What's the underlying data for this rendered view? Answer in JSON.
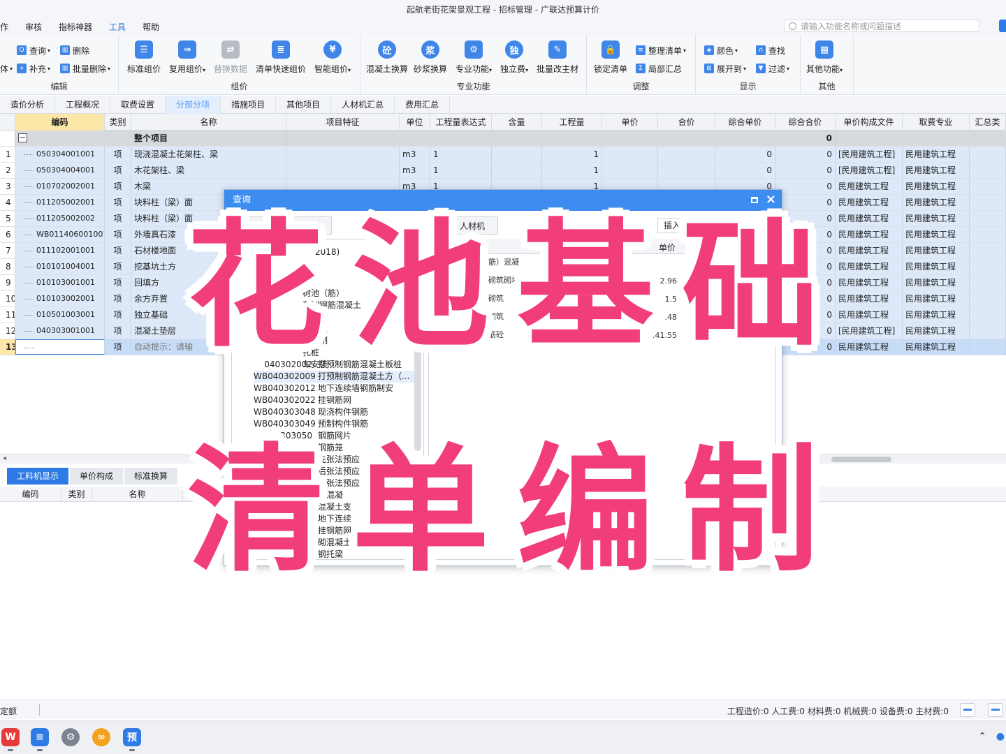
{
  "window": {
    "title": "起航老街花架景观工程 - 招标管理 - 广联达预算计价"
  },
  "menu": [
    {
      "label": "作"
    },
    {
      "label": "审核"
    },
    {
      "label": "指标神器"
    },
    {
      "label": "工具",
      "active": true
    },
    {
      "label": "帮助"
    }
  ],
  "search": {
    "placeholder": "请输入功能名称或问题描述"
  },
  "ribbon": {
    "edit": {
      "label": "编辑",
      "query": "查询",
      "delete": "删除",
      "supplement": "补充",
      "batch_delete": "批量删除",
      "partial": "体"
    },
    "group": {
      "label": "组价",
      "standard": "标准组价",
      "reuse": "复用组价",
      "replace": "替换数据",
      "quick": "清单快速组价",
      "smart": "智能组价"
    },
    "special": {
      "label": "专业功能",
      "concrete": "混凝土换算",
      "mortar": "砂浆换算",
      "pro": "专业功能",
      "solo": "独立费",
      "batch_main": "批量改主材"
    },
    "adjust": {
      "label": "调整",
      "lock": "锁定清单",
      "tidy": "整理清单",
      "partial_sum": "局部汇总"
    },
    "display": {
      "label": "显示",
      "color": "颜色",
      "find": "查找",
      "expand": "展开到",
      "filter": "过滤"
    },
    "other": {
      "label": "其他",
      "more": "其他功能"
    }
  },
  "tabs": [
    {
      "label": "造价分析"
    },
    {
      "label": "工程概况"
    },
    {
      "label": "取费设置"
    },
    {
      "label": "分部分项",
      "active": true
    },
    {
      "label": "措施项目"
    },
    {
      "label": "其他项目"
    },
    {
      "label": "人材机汇总"
    },
    {
      "label": "费用汇总"
    }
  ],
  "grid": {
    "columns": [
      "编码",
      "类别",
      "名称",
      "项目特征",
      "单位",
      "工程量表达式",
      "含量",
      "工程量",
      "单价",
      "合价",
      "综合单价",
      "综合合价",
      "单价构成文件",
      "取费专业",
      "汇总类"
    ],
    "total_row": {
      "minus": "−",
      "name": "整个项目",
      "total": "0"
    },
    "rows": [
      {
        "no": "1",
        "code": "050304001001",
        "type": "项",
        "name": "现浇混凝土花架柱、梁",
        "unit": "m3",
        "expr": "1",
        "qty": "1",
        "unit_price": "0",
        "total": "0",
        "file": "[民用建筑工程]",
        "major": "民用建筑工程"
      },
      {
        "no": "2",
        "code": "050304004001",
        "type": "项",
        "name": "木花架柱、梁",
        "unit": "m3",
        "expr": "1",
        "qty": "1",
        "unit_price": "0",
        "total": "0",
        "file": "[民用建筑工程]",
        "major": "民用建筑工程"
      },
      {
        "no": "3",
        "code": "010702002001",
        "type": "项",
        "name": "木梁",
        "unit": "m3",
        "expr": "1",
        "qty": "1",
        "unit_price": "0",
        "total": "0",
        "file": "民用建筑工程",
        "major": "民用建筑工程"
      },
      {
        "no": "4",
        "code": "011205002001",
        "type": "项",
        "name": "块料柱（梁）面",
        "unit": "",
        "expr": "",
        "qty": "",
        "unit_price": "",
        "total": "0",
        "file": "民用建筑工程",
        "major": "民用建筑工程"
      },
      {
        "no": "5",
        "code": "011205002002",
        "type": "项",
        "name": "块料柱（梁）面",
        "unit": "",
        "expr": "",
        "qty": "",
        "unit_price": "",
        "total": "0",
        "file": "民用建筑工程",
        "major": "民用建筑工程"
      },
      {
        "no": "6",
        "code": "WB011406001001",
        "type": "项",
        "name": "外墙真石漆",
        "unit": "",
        "expr": "",
        "qty": "",
        "unit_price": "",
        "total": "0",
        "file": "民用建筑工程",
        "major": "民用建筑工程"
      },
      {
        "no": "7",
        "code": "011102001001",
        "type": "项",
        "name": "石材楼地面",
        "unit": "",
        "expr": "",
        "qty": "",
        "unit_price": "",
        "total": "0",
        "file": "民用建筑工程",
        "major": "民用建筑工程"
      },
      {
        "no": "8",
        "code": "010101004001",
        "type": "项",
        "name": "挖基坑土方",
        "unit": "",
        "expr": "",
        "qty": "",
        "unit_price": "",
        "total": "0",
        "file": "民用建筑工程",
        "major": "民用建筑工程"
      },
      {
        "no": "9",
        "code": "010103001001",
        "type": "项",
        "name": "回填方",
        "unit": "",
        "expr": "",
        "qty": "",
        "unit_price": "",
        "total": "0",
        "file": "民用建筑工程",
        "major": "民用建筑工程"
      },
      {
        "no": "10",
        "code": "010103002001",
        "type": "项",
        "name": "余方弃置",
        "unit": "",
        "expr": "",
        "qty": "",
        "unit_price": "",
        "total": "0",
        "file": "民用建筑工程",
        "major": "民用建筑工程"
      },
      {
        "no": "11",
        "code": "010501003001",
        "type": "项",
        "name": "独立基础",
        "unit": "",
        "expr": "",
        "qty": "",
        "unit_price": "",
        "total": "0",
        "file": "民用建筑工程",
        "major": "民用建筑工程"
      },
      {
        "no": "12",
        "code": "040303001001",
        "type": "项",
        "name": "混凝土垫层",
        "unit": "",
        "expr": "",
        "qty": "",
        "unit_price": "",
        "total": "0",
        "file": "[民用建筑工程]",
        "major": "民用建筑工程"
      },
      {
        "no": "13",
        "code": "",
        "type": "项",
        "name": "自动提示：请输",
        "unit": "",
        "expr": "",
        "qty": "",
        "unit_price": "",
        "total": "0",
        "file": "民用建筑工程",
        "major": "民用建筑工程"
      }
    ]
  },
  "bottom": {
    "tabs": [
      {
        "label": "工料机显示",
        "active": true
      },
      {
        "label": "单价构成"
      },
      {
        "label": "标准换算"
      }
    ],
    "columns": [
      "编码",
      "类别",
      "名称"
    ]
  },
  "dialog": {
    "title": "查询",
    "tab_bill": "清单",
    "tab_material": "人材机",
    "insert": "插入",
    "year": "2018)",
    "price_header": "单价",
    "right_rows": [
      {
        "name": "筋）混凝",
        "price": ""
      },
      {
        "name": "砌筑砌块",
        "price": "2.96"
      },
      {
        "name": "砌筑",
        "price": "1.5"
      },
      {
        "name": "砌筑",
        "price": ".48"
      },
      {
        "name": "筋砼",
        "price": ".41.55"
      }
    ],
    "list_partial": [
      "树池（筋）",
      "预制钢筋混凝土",
      "00",
      "筋混凝",
      "筋笼制",
      "孔桩",
      "车安装"
    ],
    "list": [
      {
        "code": "040302002",
        "name": "打预制钢筋混凝土板桩"
      },
      {
        "code": "WB040302009",
        "name": "打预制钢筋混凝土方（...",
        "hl": true
      },
      {
        "code": "WB040302012",
        "name": "地下连续墙钢筋制安"
      },
      {
        "code": "WB040302022",
        "name": "挂钢筋网"
      },
      {
        "code": "WB040303048",
        "name": "现浇构件钢筋"
      },
      {
        "code": "WB040303049",
        "name": "预制构件钢筋"
      },
      {
        "code": "303050",
        "name": "钢筋网片"
      },
      {
        "code": "",
        "name": "钢筋笼"
      },
      {
        "code": "",
        "name": "先张法预应"
      },
      {
        "code": "",
        "name": "后张法预应"
      },
      {
        "code": "",
        "name": "后张法预应"
      },
      {
        "code": "",
        "name": "筋混凝"
      },
      {
        "code": "",
        "name": "混凝土支"
      },
      {
        "code": "",
        "name": "地下连续"
      },
      {
        "code": "",
        "name": "挂钢筋网"
      },
      {
        "code": "",
        "name": "砌混凝土"
      },
      {
        "code": "",
        "name": "钢托梁"
      }
    ]
  },
  "status": {
    "left": "定额",
    "right": "工程造价:0  人工费:0  材料费:0  机械费:0  设备费:0  主材费:0"
  },
  "overlay": {
    "line1": "花池基础",
    "line2": "清单编制",
    "color": "#f23d7b"
  }
}
